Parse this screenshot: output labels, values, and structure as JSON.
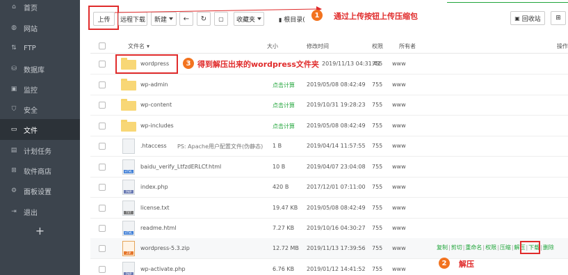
{
  "sidebar": {
    "items": [
      {
        "label": "首页",
        "icon": "home-icon"
      },
      {
        "label": "网站",
        "icon": "globe-icon"
      },
      {
        "label": "FTP",
        "icon": "ftp-icon"
      },
      {
        "label": "数据库",
        "icon": "database-icon"
      },
      {
        "label": "监控",
        "icon": "monitor-icon"
      },
      {
        "label": "安全",
        "icon": "shield-icon"
      },
      {
        "label": "文件",
        "icon": "folder-icon"
      },
      {
        "label": "计划任务",
        "icon": "calendar-icon"
      },
      {
        "label": "软件商店",
        "icon": "grid-icon"
      },
      {
        "label": "面板设置",
        "icon": "gear-icon"
      },
      {
        "label": "退出",
        "icon": "logout-icon"
      }
    ],
    "add_label": "+"
  },
  "toolbar": {
    "upload": "上传",
    "remote_download": "远程下载",
    "new": "新建",
    "favorites": "收藏夹",
    "root_dir": "根目录(",
    "recycle_bin": "回收站"
  },
  "annotations": {
    "step1_num": "1",
    "step1": "通过上传按钮上传压缩包",
    "step2_num": "2",
    "step2": "解压",
    "step3_num": "3",
    "step3": "得到解压出来的wordpress文件夹"
  },
  "table": {
    "headers": [
      "文件名",
      "大小",
      "修改时间",
      "权限",
      "所有者",
      "操作"
    ],
    "rows": [
      {
        "name": "wordpress",
        "type": "folder",
        "size": "",
        "time": "2019/11/13 04:31:41",
        "perm": "755",
        "owner": "www"
      },
      {
        "name": "wp-admin",
        "type": "folder",
        "size": "点击计算",
        "time": "2019/05/08 08:42:49",
        "perm": "755",
        "owner": "www"
      },
      {
        "name": "wp-content",
        "type": "folder",
        "size": "点击计算",
        "time": "2019/10/31 19:28:23",
        "perm": "755",
        "owner": "www"
      },
      {
        "name": "wp-includes",
        "type": "folder",
        "size": "点击计算",
        "time": "2019/05/08 08:42:49",
        "perm": "755",
        "owner": "www"
      },
      {
        "name": ".htaccess",
        "type": "file",
        "note": "PS: Apache用户配置文件(伪静态)",
        "size": "1 B",
        "time": "2019/04/14 11:57:55",
        "perm": "755",
        "owner": "www"
      },
      {
        "name": "baidu_verify_LtfzdERLCf.html",
        "type": "html",
        "size": "10 B",
        "time": "2019/04/07 23:04:08",
        "perm": "755",
        "owner": "www"
      },
      {
        "name": "index.php",
        "type": "php",
        "size": "420 B",
        "time": "2017/12/01 07:11:00",
        "perm": "755",
        "owner": "www"
      },
      {
        "name": "license.txt",
        "type": "txt",
        "size": "19.47 KB",
        "time": "2019/05/08 08:42:49",
        "perm": "755",
        "owner": "www"
      },
      {
        "name": "readme.html",
        "type": "html",
        "size": "7.27 KB",
        "time": "2019/10/16 04:30:27",
        "perm": "755",
        "owner": "www"
      },
      {
        "name": "wordpress-5.3.zip",
        "type": "zip",
        "size": "12.72 MB",
        "time": "2019/11/13 17:39:56",
        "perm": "755",
        "owner": "www"
      },
      {
        "name": "wp-activate.php",
        "type": "php",
        "size": "6.76 KB",
        "time": "2019/01/12 14:41:52",
        "perm": "755",
        "owner": "www"
      }
    ],
    "ops": [
      "复制",
      "剪切",
      "重命名",
      "权限",
      "压缩",
      "解压",
      "下载",
      "删除"
    ]
  },
  "colors": {
    "sidebar_bg": "#3c444d",
    "accent_green": "#20a53a",
    "annotation_red": "#e02b2b",
    "badge_orange": "#f2731f"
  }
}
